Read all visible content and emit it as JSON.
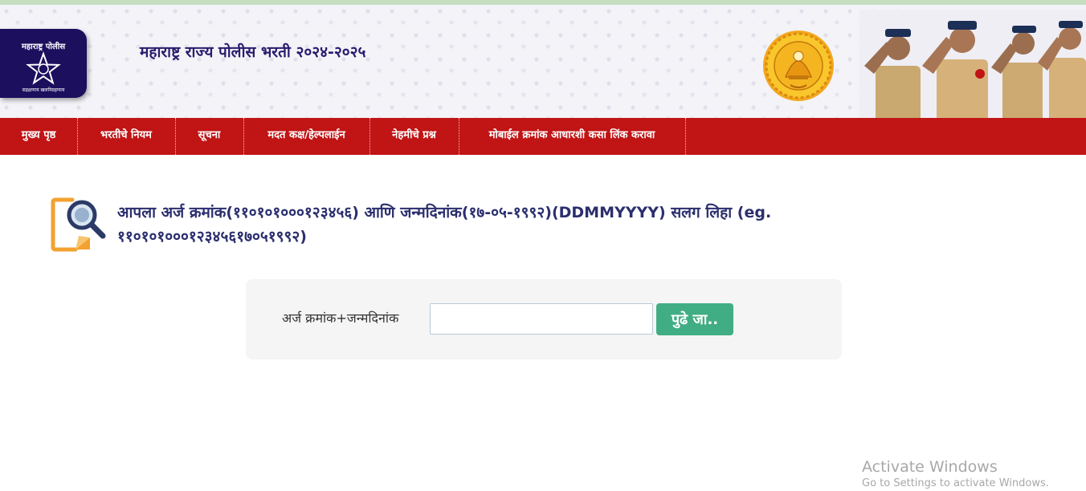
{
  "header": {
    "title": "महाराष्ट्र राज्य पोलीस भरती २०२४-२०२५",
    "logo_text": "महाराष्ट्र पोलीस",
    "logo_motto": "सद्रक्षणाय खलनिग्रहणाय",
    "emblem_icon": "maharashtra-state-emblem",
    "officers_image": "saluting-police-officers"
  },
  "nav": {
    "items": [
      {
        "label": "मुख्य पृष्ठ"
      },
      {
        "label": "भरतीचे नियम"
      },
      {
        "label": "सूचना"
      },
      {
        "label": "मदत कक्ष/हेल्पलाईन"
      },
      {
        "label": "नेहमीचे प्रश्न"
      },
      {
        "label": "मोबाईल क्रमांक आधारशी कसा लिंक करावा"
      }
    ]
  },
  "main": {
    "icon": "document-search-icon",
    "instruction": "आपला अर्ज क्रमांक(११०१०१०००१२३४५६) आणि जन्मदिनांक(१७-०५-१९९२)(DDMMYYYY) सलग लिहा (eg. ११०१०१०००१२३४५६१७०५१९९२)",
    "form": {
      "label": "अर्ज क्रमांक+जन्मदिनांक",
      "input_value": "",
      "input_placeholder": "",
      "submit_label": "पुढे जा.."
    }
  },
  "watermark": {
    "title": "Activate Windows",
    "subtitle": "Go to Settings to activate Windows."
  },
  "colors": {
    "nav_bg": "#c01415",
    "title_color": "#2a1c6e",
    "button_bg": "#41ad85",
    "instruction_color": "#2b2f6e",
    "logo_bg": "#1c0f5e"
  }
}
